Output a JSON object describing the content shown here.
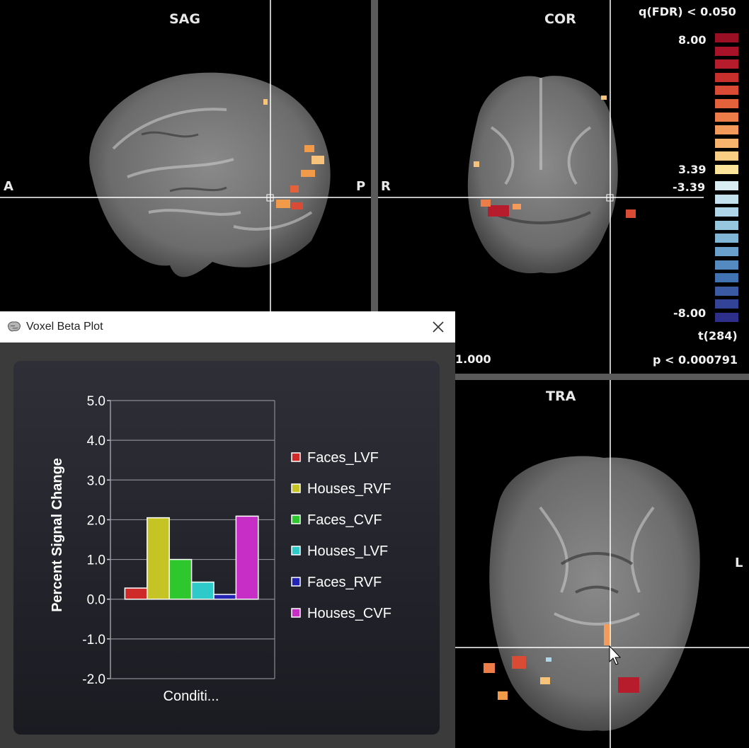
{
  "views": {
    "sag": {
      "label": "SAG",
      "left": "A",
      "right": "P"
    },
    "cor": {
      "label": "COR",
      "left": "R"
    },
    "tra": {
      "label": "TRA",
      "right": "L"
    }
  },
  "colorbar": {
    "threshold_label": "q(FDR) < 0.050",
    "max": "8.00",
    "pos_thresh": "3.39",
    "neg_thresh": "-3.39",
    "min": "-8.00",
    "stat_label": "t(284)",
    "p_label": "p < 0.000791",
    "left_value": "1.000",
    "pos_colors": [
      "#9b0f25",
      "#a8132a",
      "#b61c2c",
      "#c72f2c",
      "#d94b34",
      "#e3623c",
      "#ec7d48",
      "#f49a5a",
      "#f8b46c",
      "#fbcf83",
      "#fde49b"
    ],
    "neg_colors": [
      "#d9ecf2",
      "#c4e2ee",
      "#aed6e8",
      "#97c7df",
      "#80b5d6",
      "#6aa1cc",
      "#548ac0",
      "#4173b3",
      "#3a5aa4",
      "#334397",
      "#2d2f8a"
    ]
  },
  "window": {
    "title": "Voxel Beta Plot",
    "brain_icon": "brain-icon",
    "close_icon": "close-icon"
  },
  "chart_data": {
    "type": "bar",
    "ylabel": "Percent Signal Change",
    "xlabel": "Conditi...",
    "ylim": [
      -2.0,
      5.0
    ],
    "yticks": [
      "5.0",
      "4.0",
      "3.0",
      "2.0",
      "1.0",
      "0.0",
      "-1.0",
      "-2.0"
    ],
    "grid": true,
    "legend_position": "right",
    "series": [
      {
        "name": "Faces_LVF",
        "value": 0.28,
        "color": "#cf2a2a"
      },
      {
        "name": "Houses_RVF",
        "value": 2.05,
        "color": "#c6c424"
      },
      {
        "name": "Faces_CVF",
        "value": 1.0,
        "color": "#2ec82e"
      },
      {
        "name": "Houses_LVF",
        "value": 0.43,
        "color": "#2ec9c9"
      },
      {
        "name": "Faces_RVF",
        "value": 0.12,
        "color": "#2323b4"
      },
      {
        "name": "Houses_CVF",
        "value": 2.09,
        "color": "#c62ec6"
      }
    ]
  }
}
